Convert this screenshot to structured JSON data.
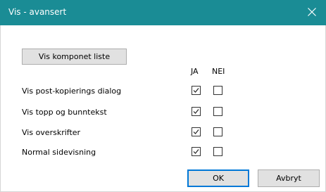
{
  "window": {
    "title": "Vis - avansert",
    "close_icon": "close-icon"
  },
  "buttons": {
    "component_list": "Vis komponet liste",
    "ok": "OK",
    "cancel": "Avbryt"
  },
  "columns": {
    "yes": "JA",
    "no": "NEI"
  },
  "options": [
    {
      "label": "Vis post-kopierings dialog",
      "yes": true,
      "no": false
    },
    {
      "label": "Vis topp og bunntekst",
      "yes": true,
      "no": false
    },
    {
      "label": "Vis overskrifter",
      "yes": true,
      "no": false
    },
    {
      "label": "Normal sidevisning",
      "yes": true,
      "no": false
    }
  ],
  "colors": {
    "titlebar": "#1a8c95",
    "default_button_border": "#0078d7"
  }
}
